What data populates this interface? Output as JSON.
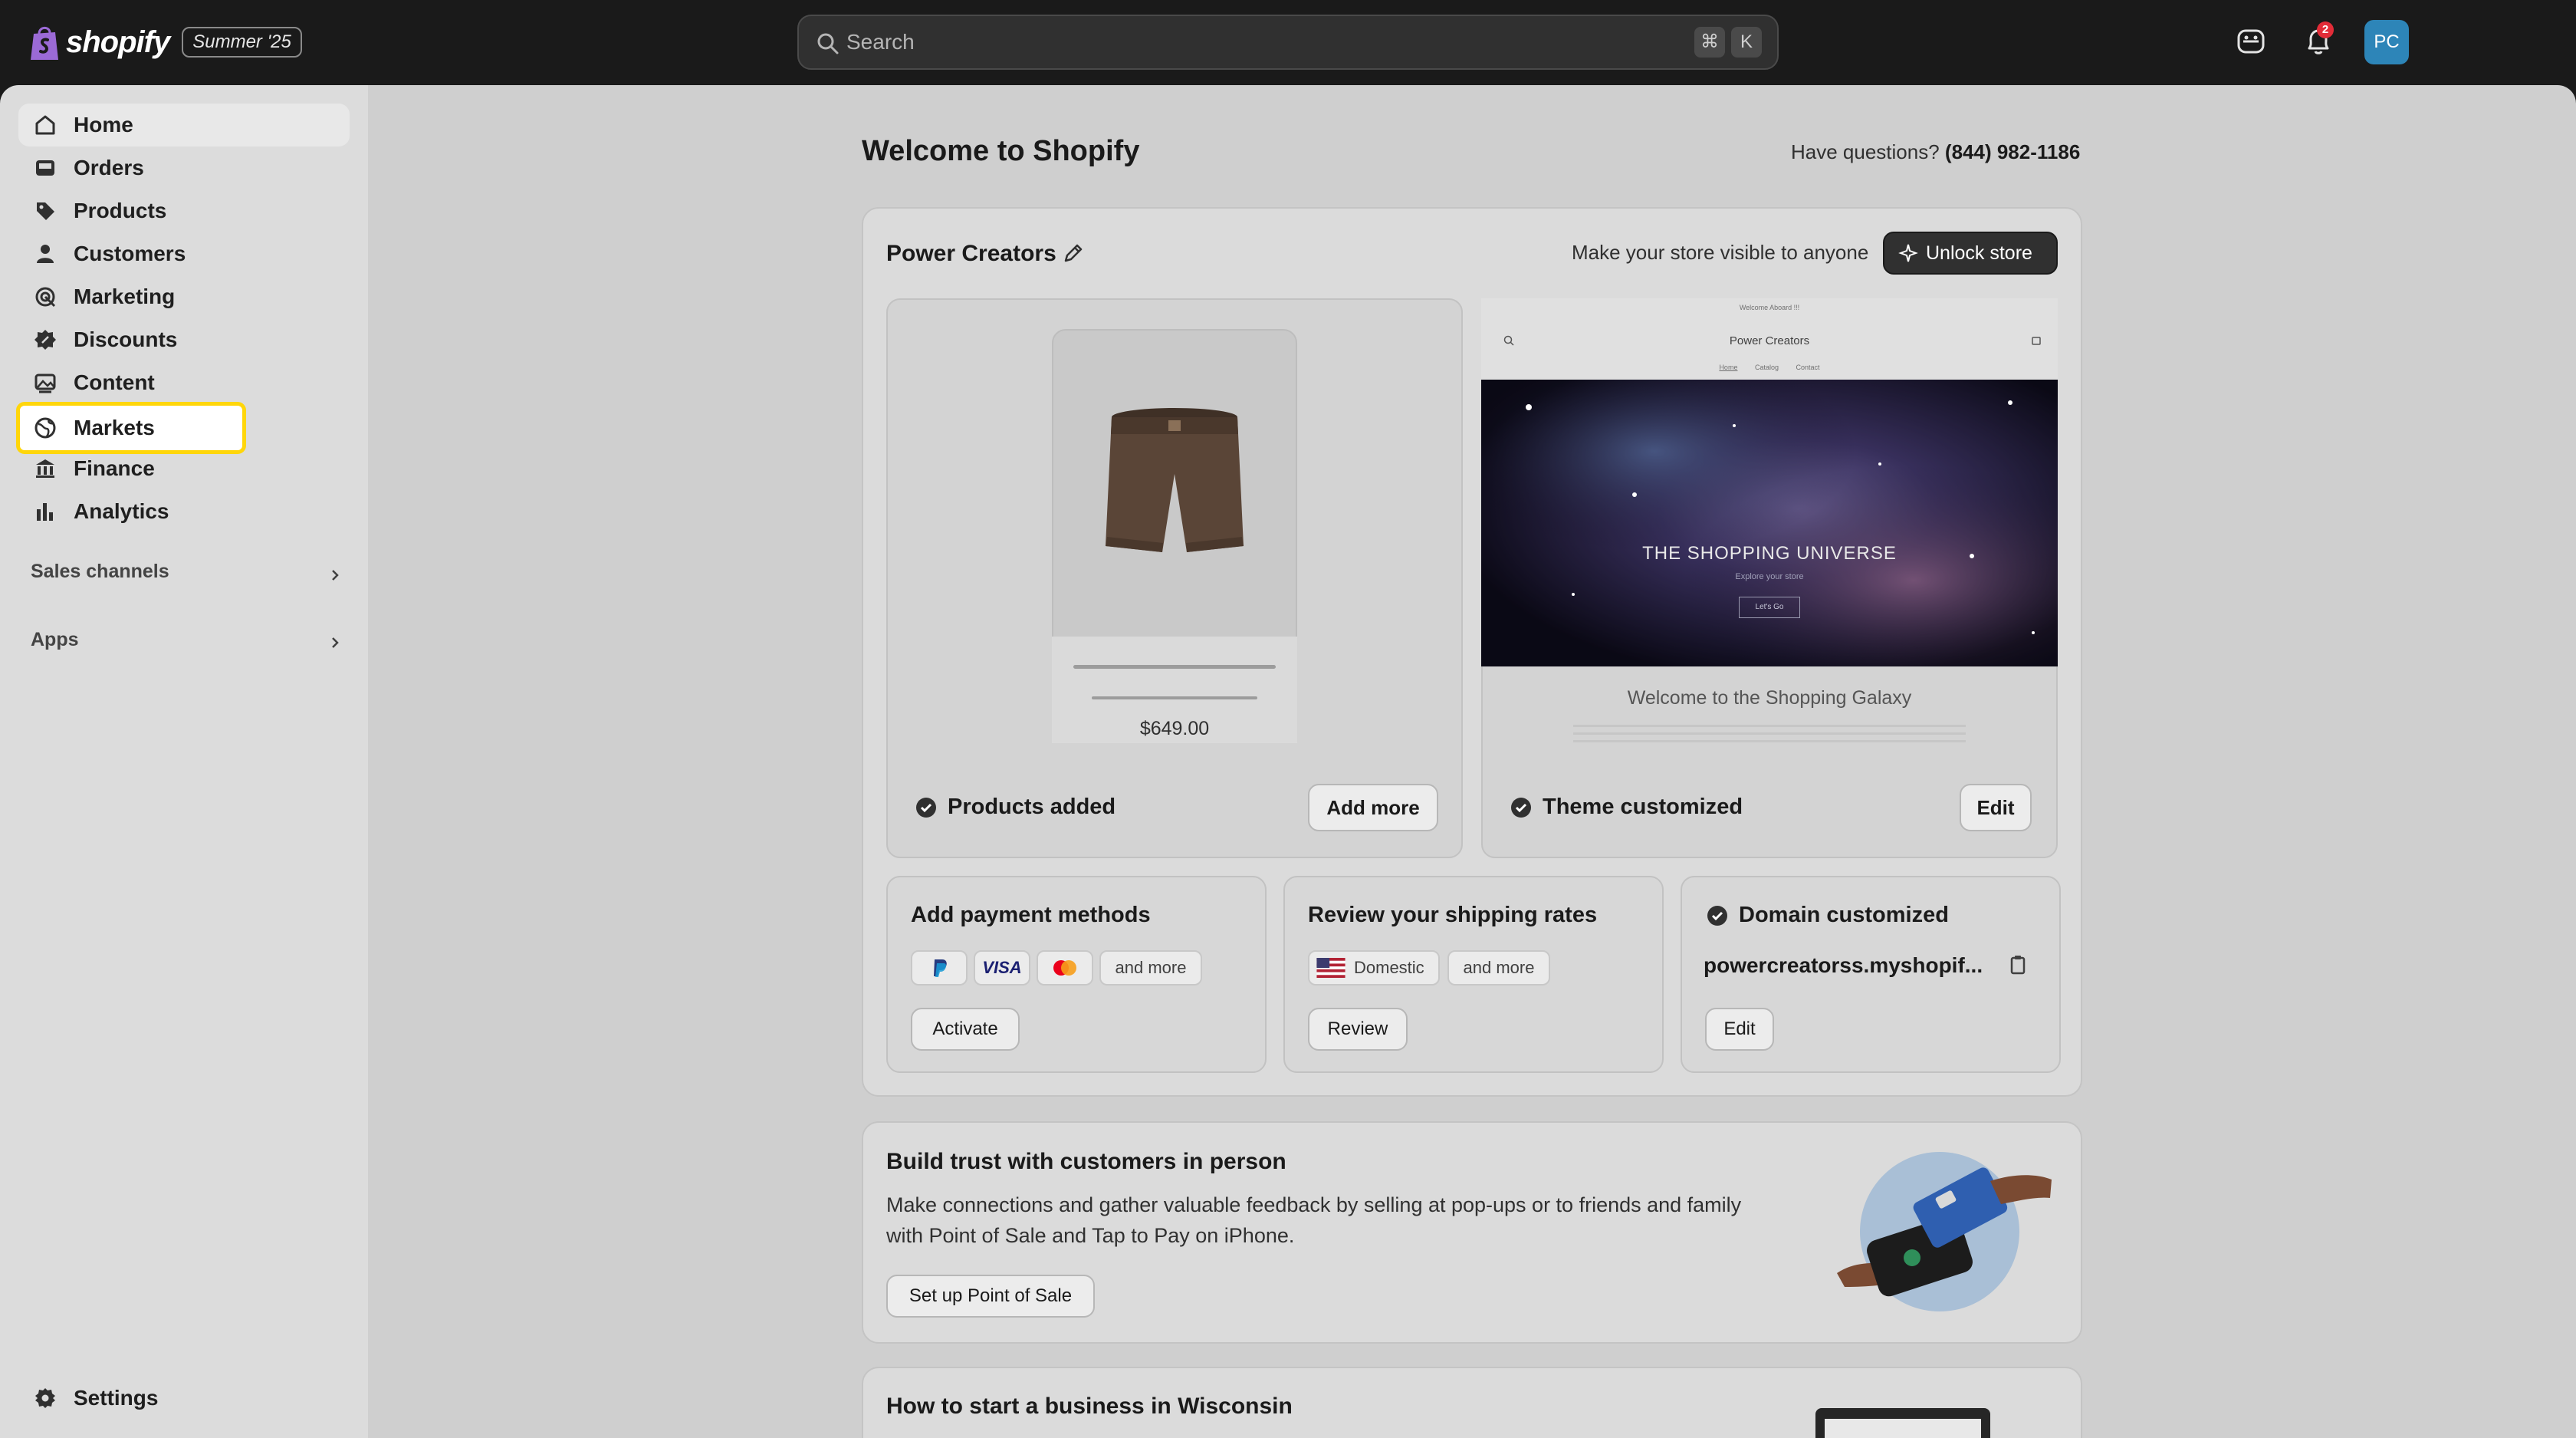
{
  "topbar": {
    "brand": "shopify",
    "edition": "Summer '25",
    "search_placeholder": "Search",
    "shortcut_keys": [
      "⌘",
      "K"
    ],
    "notification_count": "2",
    "avatar_initials": "PC"
  },
  "sidebar": {
    "items": [
      {
        "label": "Home",
        "icon": "home-icon"
      },
      {
        "label": "Orders",
        "icon": "inbox-icon"
      },
      {
        "label": "Products",
        "icon": "tag-icon"
      },
      {
        "label": "Customers",
        "icon": "person-icon"
      },
      {
        "label": "Marketing",
        "icon": "target-icon"
      },
      {
        "label": "Discounts",
        "icon": "discount-icon"
      },
      {
        "label": "Content",
        "icon": "image-icon"
      },
      {
        "label": "Markets",
        "icon": "globe-icon"
      },
      {
        "label": "Finance",
        "icon": "bank-icon"
      },
      {
        "label": "Analytics",
        "icon": "bar-chart-icon"
      }
    ],
    "sections": [
      "Sales channels",
      "Apps"
    ],
    "settings_label": "Settings"
  },
  "main": {
    "title": "Welcome to Shopify",
    "help_prefix": "Have questions?",
    "help_phone": "(844) 982-1186",
    "setup": {
      "store_name": "Power Creators",
      "visibility_text": "Make your store visible to anyone",
      "unlock_label": "Unlock store",
      "products": {
        "price": "$649.00",
        "status": "Products added",
        "button": "Add more"
      },
      "theme": {
        "welcome_banner": "Welcome Aboard !!!",
        "store_name": "Power Creators",
        "nav": [
          "Home",
          "Catalog",
          "Contact"
        ],
        "hero_title": "THE SHOPPING UNIVERSE",
        "hero_sub": "Explore your store",
        "hero_button": "Let's Go",
        "tagline": "Welcome to the Shopping Galaxy",
        "status": "Theme customized",
        "button": "Edit"
      },
      "payment": {
        "title": "Add payment methods",
        "methods": [
          "paypal-icon",
          "VISA",
          "mastercard-icon"
        ],
        "more": "and more",
        "button": "Activate"
      },
      "shipping": {
        "title": "Review your shipping rates",
        "domestic": "Domestic",
        "more": "and more",
        "button": "Review"
      },
      "domain": {
        "title": "Domain customized",
        "value": "powercreatorss.myshopif...",
        "button": "Edit"
      }
    },
    "pos": {
      "title": "Build trust with customers in person",
      "description": "Make connections and gather valuable feedback by selling at pop-ups or to friends and family with Point of Sale and Tap to Pay on iPhone.",
      "button": "Set up Point of Sale"
    },
    "wisconsin": {
      "title": "How to start a business in Wisconsin"
    }
  },
  "colors": {
    "topbar": "#1a1a1a",
    "highlight": "#ffd60a",
    "avatar": "#2d85b8",
    "badge": "#e22c38"
  }
}
